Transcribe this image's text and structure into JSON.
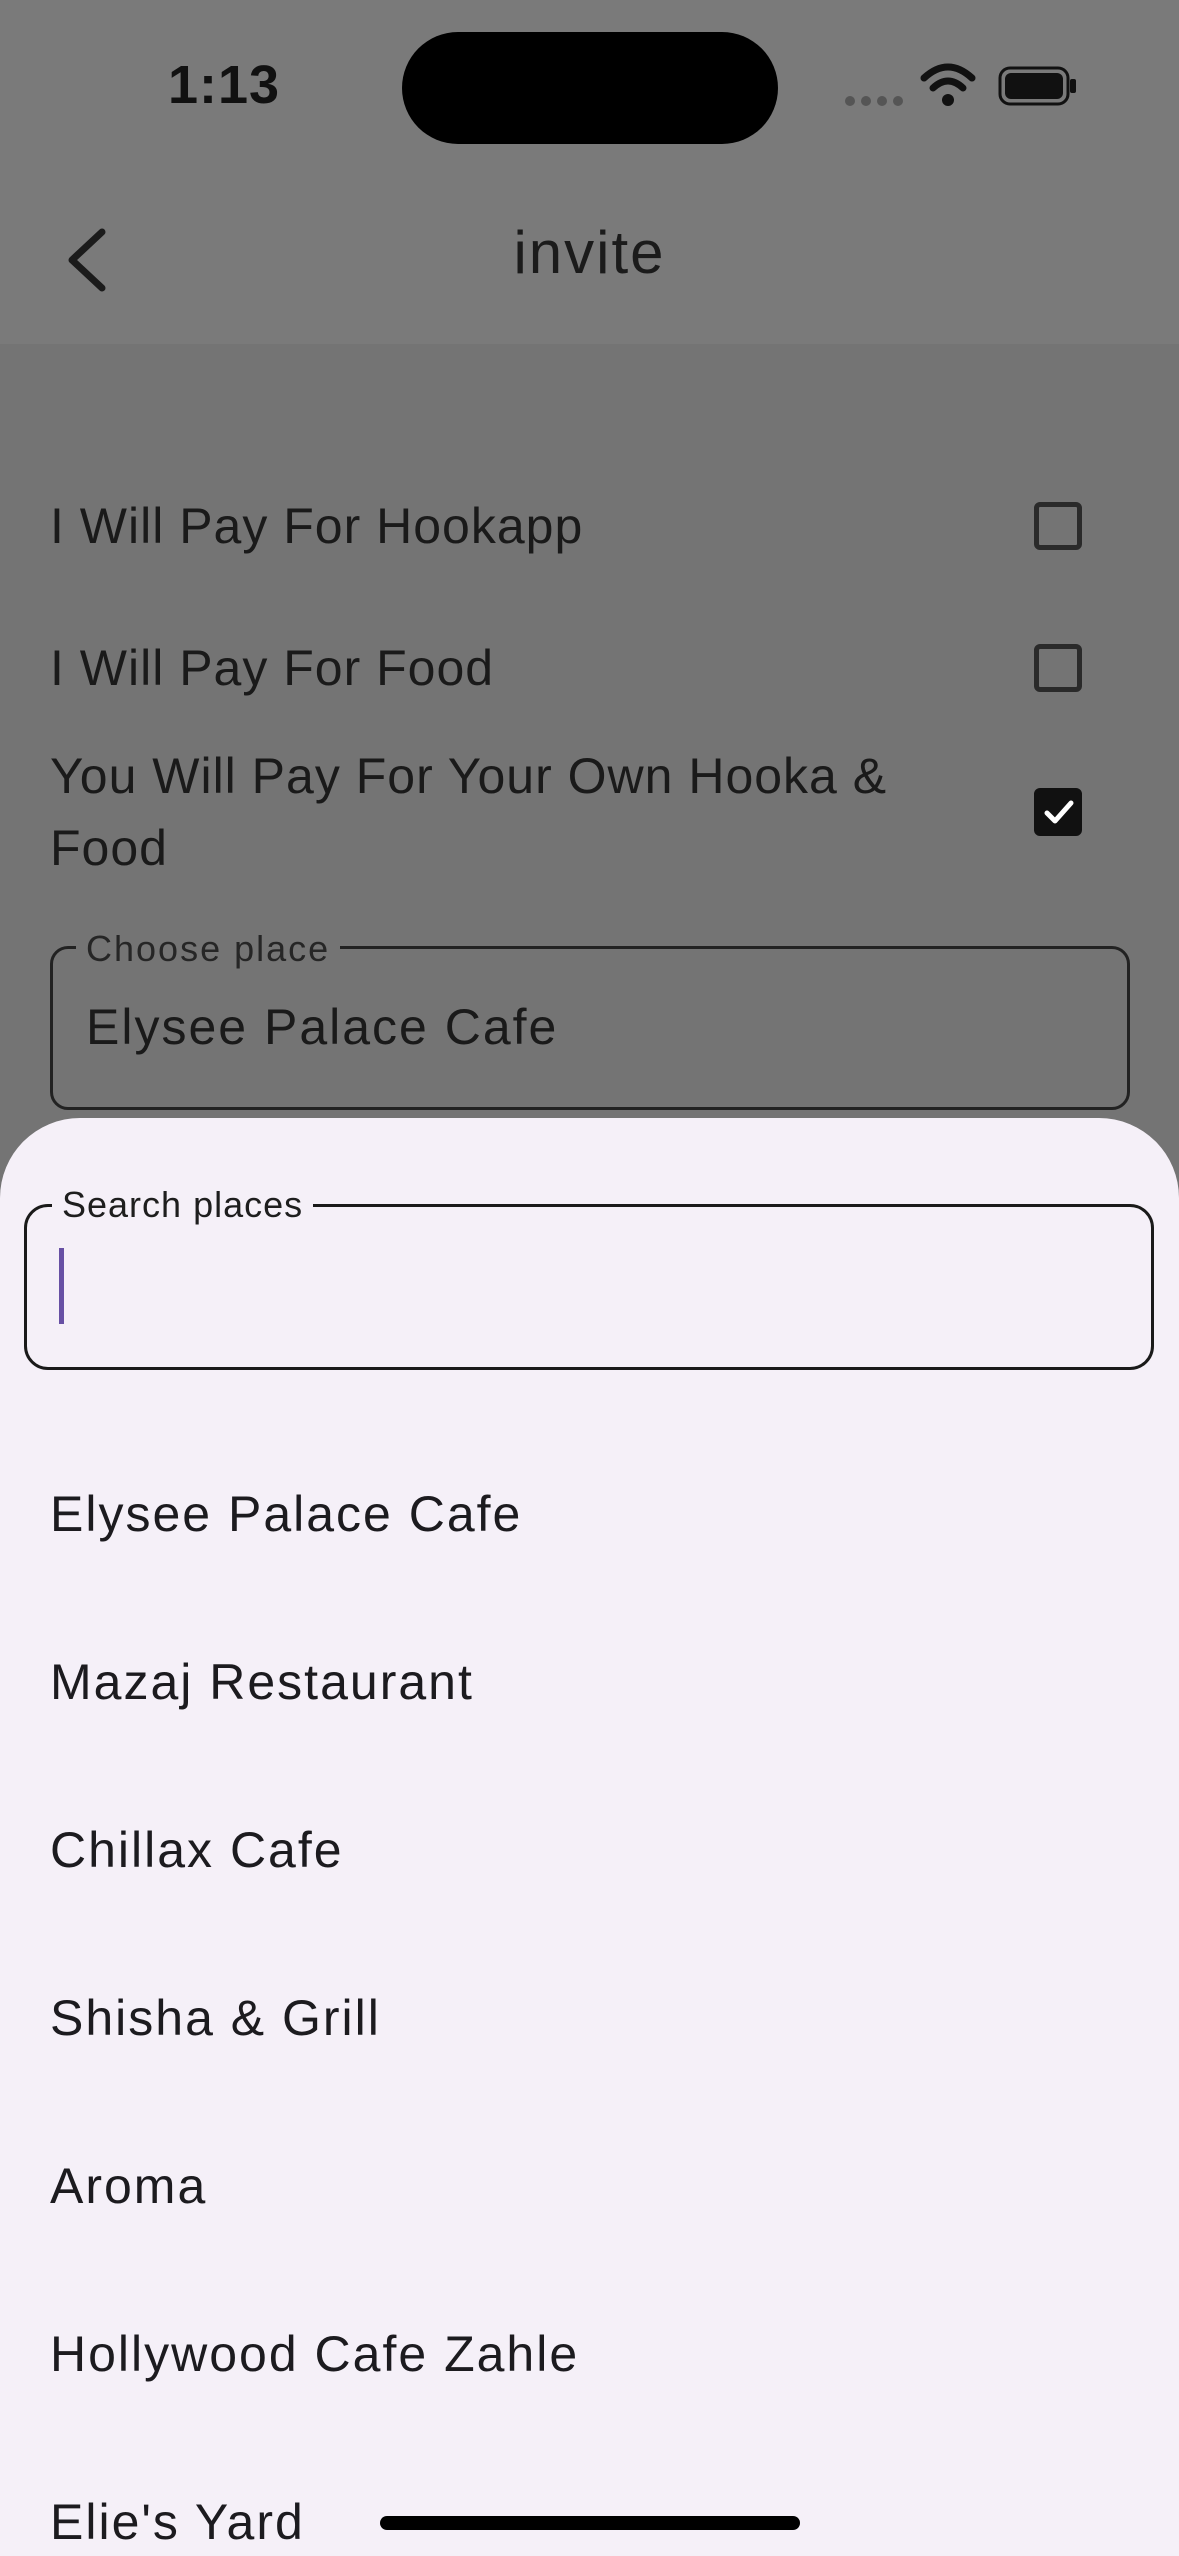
{
  "status_bar": {
    "time": "1:13"
  },
  "app_bar": {
    "title": "invite",
    "back_icon": "chevron-left-icon"
  },
  "options": [
    {
      "label": "I Will Pay For Hookapp",
      "checked": false
    },
    {
      "label": "I Will Pay For Food",
      "checked": false
    },
    {
      "label": "You Will Pay For Your Own Hooka & Food",
      "checked": true
    }
  ],
  "place_field": {
    "label": "Choose place",
    "value": "Elysee Palace Cafe"
  },
  "sheet": {
    "search": {
      "label": "Search places",
      "value": ""
    },
    "places": [
      "Elysee Palace Cafe",
      "Mazaj Restaurant",
      "Chillax Cafe",
      "Shisha & Grill",
      "Aroma",
      "Hollywood Cafe Zahle",
      "Elie's Yard"
    ]
  },
  "colors": {
    "scrim_background": "#757575",
    "sheet_background": "#f5f0f8",
    "caret": "#6750a4"
  }
}
